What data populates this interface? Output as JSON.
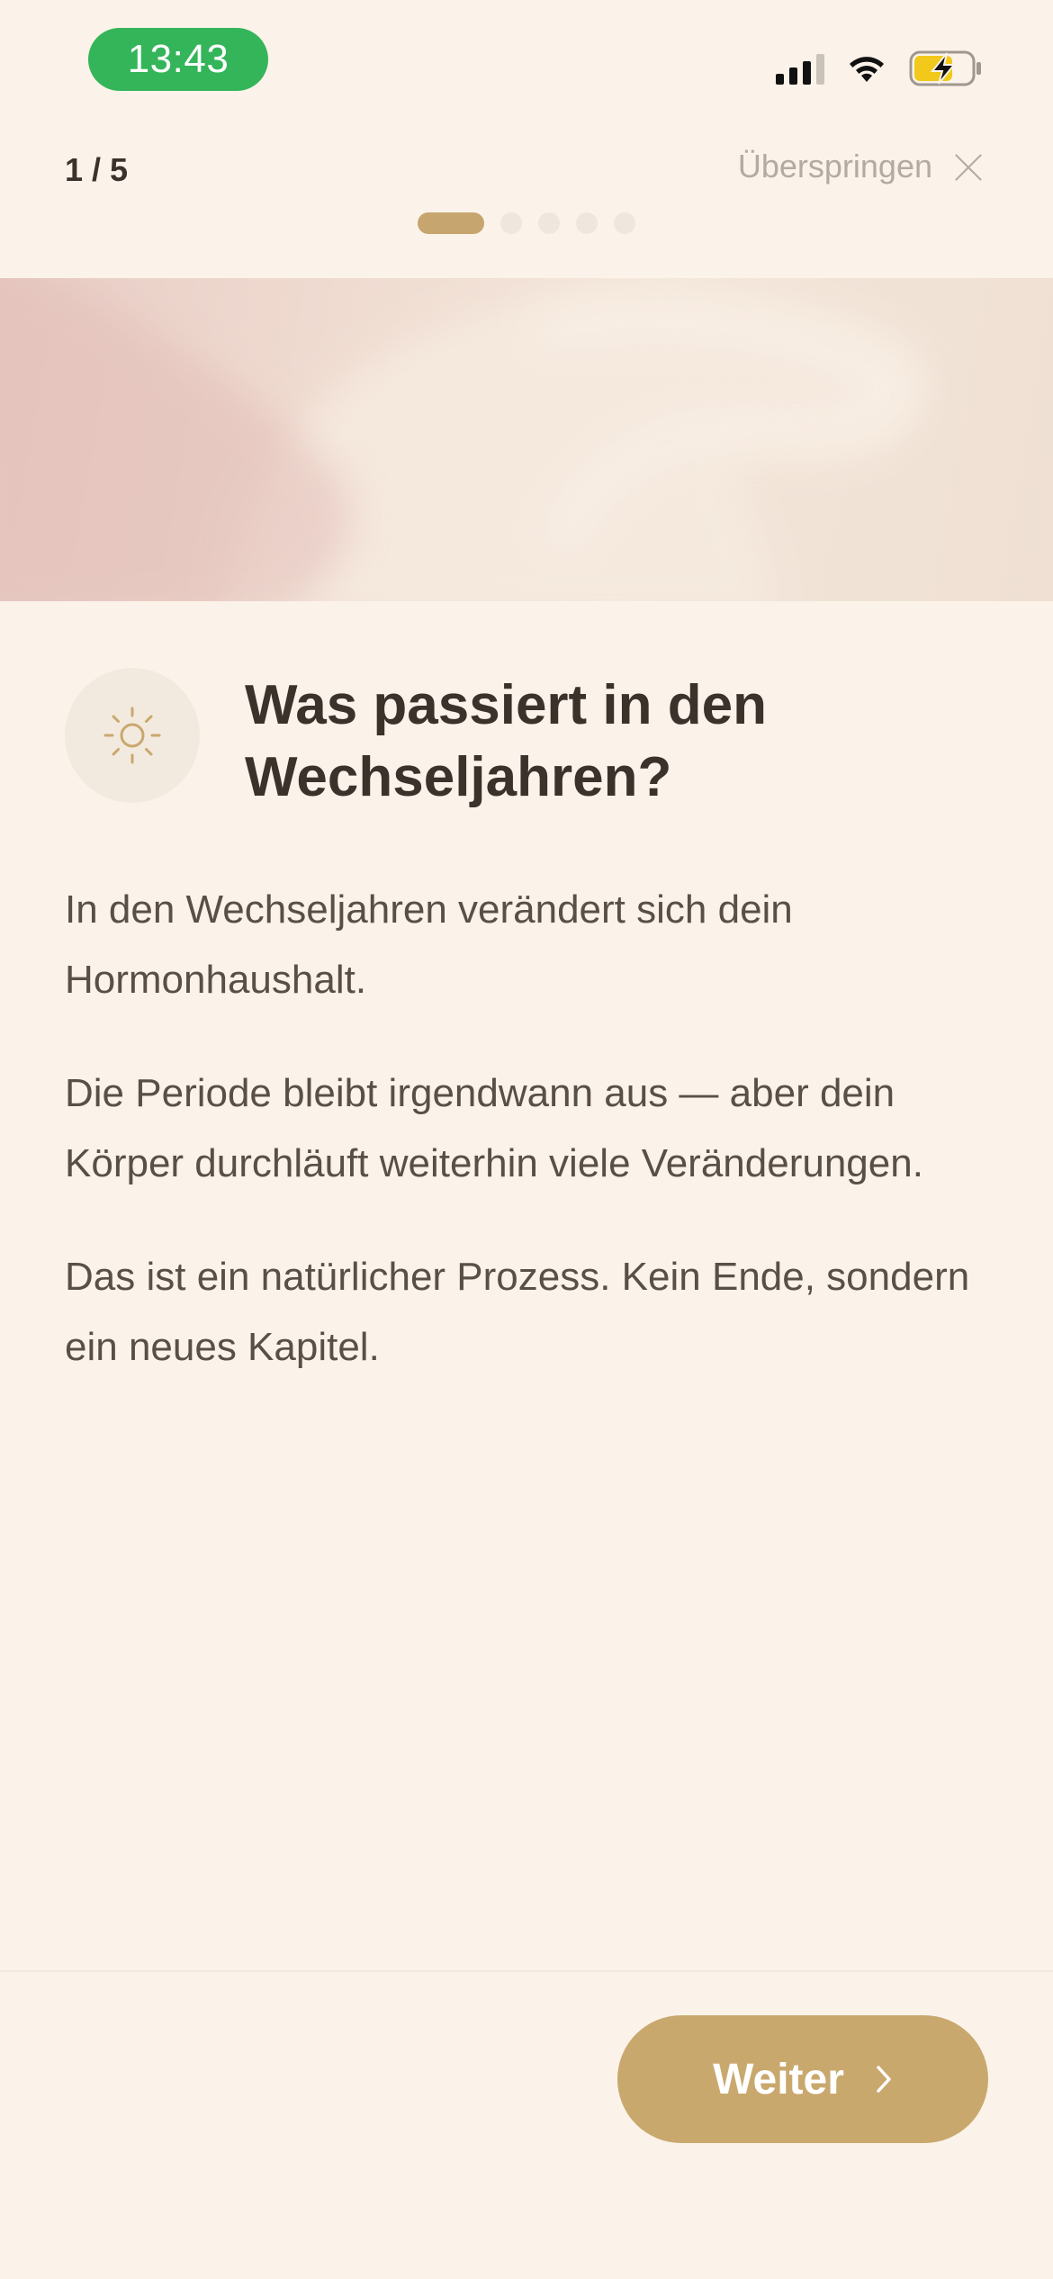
{
  "status_bar": {
    "time": "13:43"
  },
  "header": {
    "page_counter": "1 / 5",
    "skip_label": "Überspringen",
    "pagination": {
      "total": 5,
      "active_index": 0
    }
  },
  "content": {
    "title": "Was passiert in den Wechseljahren?",
    "icon": "sun-icon",
    "paragraphs": [
      "In den Wechseljahren verändert sich dein Hormonhaushalt.",
      "Die Periode bleibt irgendwann aus — aber dein Körper durchläuft weiterhin viele Veränderungen.",
      "Das ist ein natürlicher Prozess. Kein Ende, sondern ein neues Kapitel."
    ]
  },
  "footer": {
    "next_label": "Weiter"
  },
  "colors": {
    "background": "#FBF3EA",
    "accent": "#C9A86E",
    "time_pill": "#34B55A",
    "battery_charging": "#F2C81A"
  }
}
